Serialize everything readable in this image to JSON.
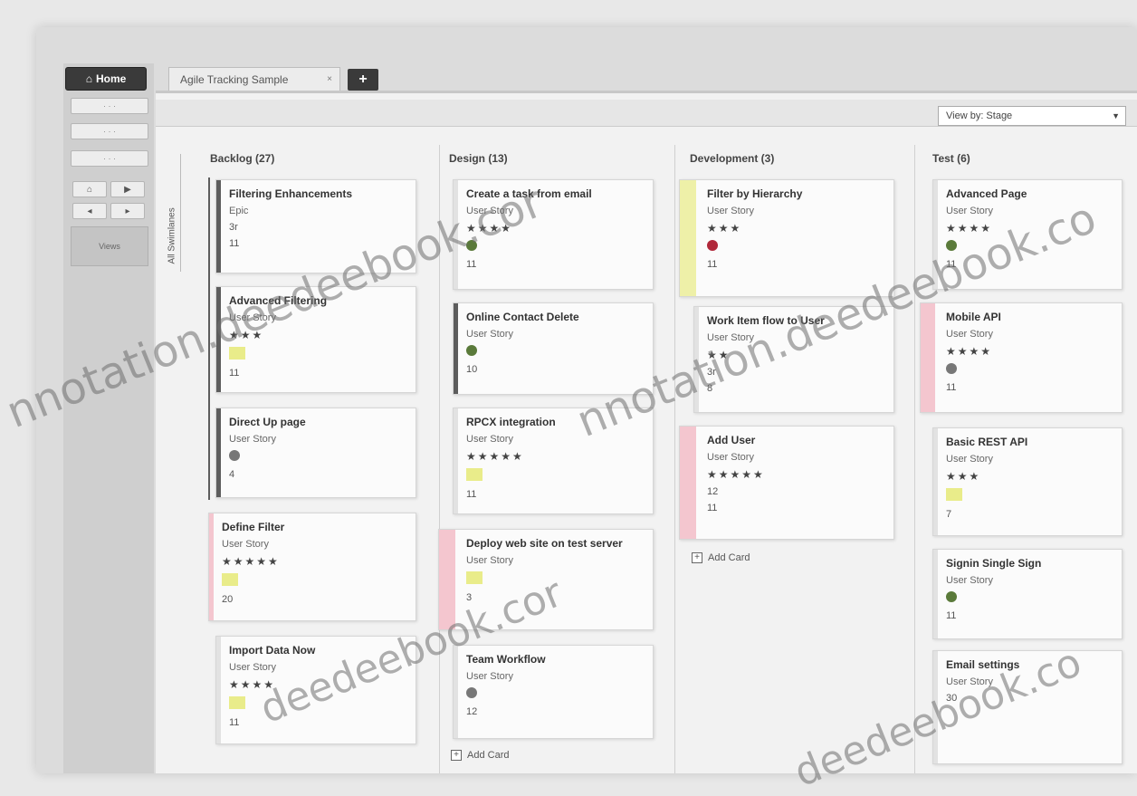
{
  "toolbar": {
    "home_label": "Home",
    "tab_label": "Agile Tracking Sample",
    "tab_close": "×",
    "new_tab_label": "+"
  },
  "rail": {
    "buttons": [
      "· · ·",
      "· · ·",
      "· · ·"
    ],
    "small": [
      "⌂",
      "▶",
      "◂",
      "▸"
    ],
    "panel_label": "Views"
  },
  "view_select": {
    "label": "View by: Stage"
  },
  "swimlane": {
    "label": "All Swimlanes"
  },
  "columns": [
    {
      "title": "Backlog (27)"
    },
    {
      "title": "Design (13)"
    },
    {
      "title": "Development (3)"
    },
    {
      "title": "Test (6)"
    }
  ],
  "cards": {
    "backlog": [
      {
        "title": "Filtering Enhancements",
        "type": "Epic",
        "stars": "",
        "num": "11",
        "extra": "3r"
      },
      {
        "title": "Advanced Filtering",
        "type": "User Story",
        "stars": "★★★",
        "num": "11"
      },
      {
        "title": "Direct Up page",
        "type": "User Story",
        "stars": "",
        "num": "4"
      },
      {
        "title": "Define Filter",
        "type": "User Story",
        "stars": "★★★★★",
        "num": "20"
      },
      {
        "title": "Import Data Now",
        "type": "User Story",
        "stars": "★★★★",
        "num": "11"
      }
    ],
    "design": [
      {
        "title": "Create a task from email",
        "type": "User Story",
        "stars": "★★★★",
        "num": "11"
      },
      {
        "title": "Online Contact Delete",
        "type": "User Story",
        "stars": "",
        "num": "10"
      },
      {
        "title": "RPCX integration",
        "type": "User Story",
        "stars": "★★★★★",
        "num": "11"
      },
      {
        "title": "Deploy web site on test server",
        "type": "User Story",
        "stars": "",
        "num": "3"
      },
      {
        "title": "Team Workflow",
        "type": "User Story",
        "stars": "",
        "num": "12"
      }
    ],
    "development": [
      {
        "title": "Filter by Hierarchy",
        "type": "User Story",
        "stars": "★★★",
        "num": "11"
      },
      {
        "title": "Work Item flow to User",
        "type": "User Story",
        "stars": "★★",
        "num": "8",
        "extra": "3r"
      },
      {
        "title": "Add User",
        "type": "User Story",
        "stars": "★★★★★",
        "num": "11",
        "extra": "12"
      }
    ],
    "test": [
      {
        "title": "Advanced Page",
        "type": "User Story",
        "stars": "★★★★",
        "num": "11"
      },
      {
        "title": "Mobile API",
        "type": "User Story",
        "stars": "★★★★",
        "num": "11"
      },
      {
        "title": "Basic REST API",
        "type": "User Story",
        "stars": "★★★",
        "num": "7"
      },
      {
        "title": "Signin Single Sign",
        "type": "User Story",
        "stars": "",
        "num": "11"
      },
      {
        "title": "Email settings",
        "type": "User Story",
        "stars": "",
        "num": "30"
      }
    ]
  },
  "add_card_label": "Add Card",
  "watermarks": [
    "nnotation.deedeebook.cor",
    "nnotation.deedeebook.co",
    "deedeebook.cor",
    "deedeebook.co",
    ".cor",
    ".co"
  ],
  "colors": {
    "pink": "#f4c6cf",
    "yellow": "#eef0a8",
    "dark": "#5d5d5d",
    "green": "#5a7a3a",
    "red": "#b0283a"
  }
}
